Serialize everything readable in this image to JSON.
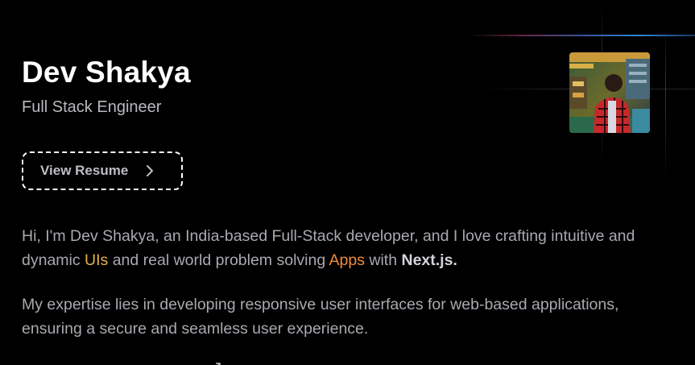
{
  "header": {
    "name": "Dev Shakya",
    "role": "Full Stack Engineer"
  },
  "resume_button": {
    "label": "View Resume",
    "icon": "chevron-right-icon"
  },
  "avatar": {
    "alt": "Dev Shakya"
  },
  "bio": {
    "p1_a": "Hi, I'm Dev Shakya, an India-based Full-Stack developer, and I love crafting intuitive and dynamic ",
    "p1_ui": "UIs",
    "p1_b": " and real world problem solving ",
    "p1_apps": "Apps",
    "p1_c": " with ",
    "p1_next": "Next.js.",
    "p2": "My expertise lies in developing responsive user interfaces for web-based applications, ensuring a secure and seamless user experience."
  },
  "colors": {
    "background": "#000000",
    "heading": "#ffffff",
    "muted_text": "#a9a9b0",
    "highlight_uis": "#e3b24a",
    "highlight_apps": "#f28a3c"
  }
}
